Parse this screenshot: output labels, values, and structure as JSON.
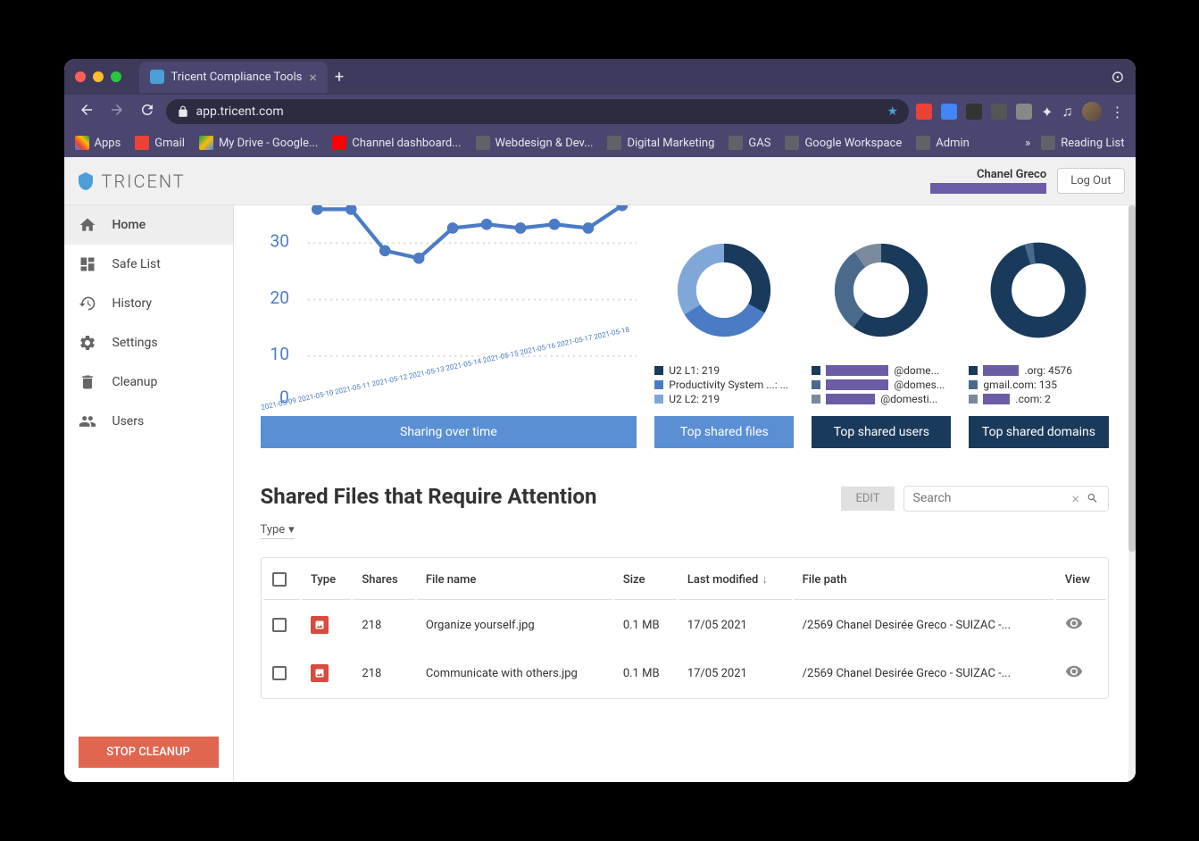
{
  "browser": {
    "tab_title": "Tricent Compliance Tools",
    "url": "app.tricent.com",
    "bookmarks": [
      {
        "label": "Apps",
        "color": "#4285f4"
      },
      {
        "label": "Gmail",
        "color": "#ea4335"
      },
      {
        "label": "My Drive - Google...",
        "color": "#0f9d58"
      },
      {
        "label": "Channel dashboard...",
        "color": "#ff0000"
      },
      {
        "label": "Webdesign & Dev...",
        "color": "#5f6368"
      },
      {
        "label": "Digital Marketing",
        "color": "#5f6368"
      },
      {
        "label": "GAS",
        "color": "#5f6368"
      },
      {
        "label": "Google Workspace",
        "color": "#5f6368"
      },
      {
        "label": "Admin",
        "color": "#5f6368"
      }
    ],
    "reading_list": "Reading List"
  },
  "app": {
    "logo_text": "TRICENT",
    "user_name": "Chanel Greco",
    "logout": "Log Out",
    "stop_cleanup": "STOP CLEANUP",
    "sidebar": [
      {
        "label": "Home",
        "icon": "home",
        "active": true
      },
      {
        "label": "Safe List",
        "icon": "dashboard",
        "active": false
      },
      {
        "label": "History",
        "icon": "history",
        "active": false
      },
      {
        "label": "Settings",
        "icon": "settings",
        "active": false
      },
      {
        "label": "Cleanup",
        "icon": "cleanup",
        "active": false
      },
      {
        "label": "Users",
        "icon": "users",
        "active": false
      }
    ],
    "charts": [
      {
        "title": "Sharing over time",
        "btn_class": "light",
        "legend": []
      },
      {
        "title": "Top shared files",
        "btn_class": "light",
        "legend": [
          {
            "color": "#1a3a5c",
            "text": "U2 L1: 219"
          },
          {
            "color": "#4a7bc4",
            "text": "Productivity System ...: ..."
          },
          {
            "color": "#7fa8d9",
            "text": "U2 L2: 219"
          }
        ]
      },
      {
        "title": "Top shared users",
        "btn_class": "dark",
        "legend": [
          {
            "color": "#1a3a5c",
            "text": "@dome...",
            "redacted": true
          },
          {
            "color": "#4a6a8c",
            "text": "@domes...",
            "redacted": true
          },
          {
            "color": "#7a8a9c",
            "text": "@domesti...",
            "redacted": true
          }
        ]
      },
      {
        "title": "Top shared domains",
        "btn_class": "dark",
        "legend": [
          {
            "color": "#1a3a5c",
            "text": ".org: 4576",
            "redacted_prefix": true
          },
          {
            "color": "#4a6a8c",
            "text": "gmail.com: 135"
          },
          {
            "color": "#7a8a9c",
            "text": ".com: 2",
            "redacted_prefix": true
          }
        ]
      }
    ],
    "section_title": "Shared Files that Require Attention",
    "edit_btn": "EDIT",
    "search_placeholder": "Search",
    "type_filter": "Type",
    "table": {
      "headers": [
        "",
        "Type",
        "Shares",
        "File name",
        "Size",
        "Last modified",
        "File path",
        "View"
      ],
      "rows": [
        {
          "shares": "218",
          "filename": "Organize yourself.jpg",
          "size": "0.1 MB",
          "modified": "17/05 2021",
          "path": "/2569 Chanel Desirée Greco - SUIZAC -..."
        },
        {
          "shares": "218",
          "filename": "Communicate with others.jpg",
          "size": "0.1 MB",
          "modified": "17/05 2021",
          "path": "/2569 Chanel Desirée Greco - SUIZAC -..."
        }
      ]
    }
  },
  "chart_data": [
    {
      "type": "line",
      "title": "Sharing over time",
      "x": [
        "2021-05-09",
        "2021-05-10",
        "2021-05-11",
        "2021-05-12",
        "2021-05-13",
        "2021-05-14",
        "2021-05-15",
        "2021-05-16",
        "2021-05-17",
        "2021-05-18"
      ],
      "values": [
        33,
        33,
        26,
        25,
        30,
        31,
        30,
        31,
        30,
        34
      ],
      "ylim": [
        0,
        40
      ],
      "yticks": [
        0,
        10,
        20,
        30,
        40
      ]
    },
    {
      "type": "pie",
      "title": "Top shared files",
      "series": [
        {
          "name": "U2 L1",
          "value": 219,
          "color": "#1a3a5c"
        },
        {
          "name": "Productivity System ...",
          "value": 219,
          "color": "#4a7bc4"
        },
        {
          "name": "U2 L2",
          "value": 219,
          "color": "#7fa8d9"
        }
      ]
    },
    {
      "type": "pie",
      "title": "Top shared users",
      "series": [
        {
          "name": "(redacted)@dome...",
          "value": 60,
          "color": "#1a3a5c"
        },
        {
          "name": "(redacted)@domes...",
          "value": 30,
          "color": "#4a6a8c"
        },
        {
          "name": "(redacted)@domesti...",
          "value": 10,
          "color": "#7a8a9c"
        }
      ]
    },
    {
      "type": "pie",
      "title": "Top shared domains",
      "series": [
        {
          "name": "(redacted).org",
          "value": 4576,
          "color": "#1a3a5c"
        },
        {
          "name": "gmail.com",
          "value": 135,
          "color": "#4a6a8c"
        },
        {
          "name": "(redacted).com",
          "value": 2,
          "color": "#7a8a9c"
        }
      ]
    }
  ]
}
